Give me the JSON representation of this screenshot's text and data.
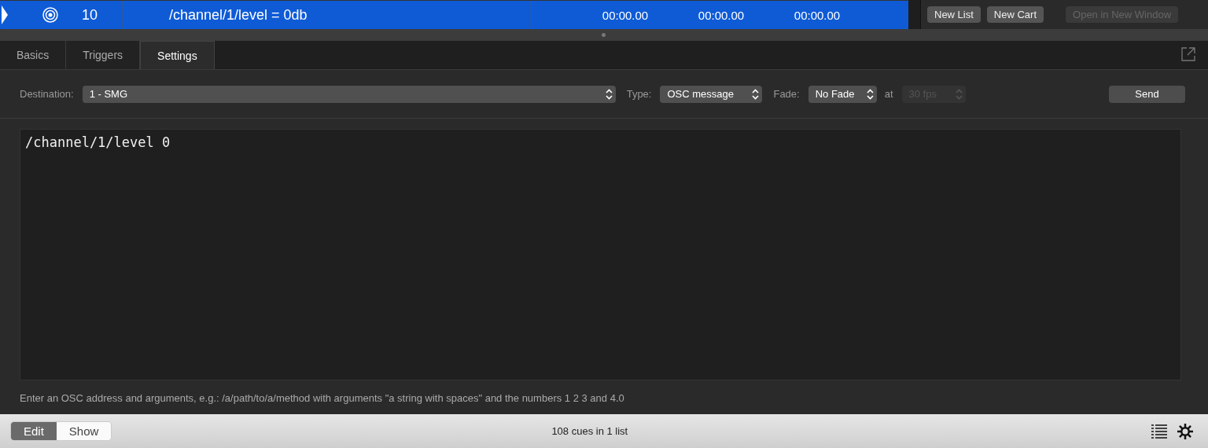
{
  "cue_row": {
    "selected": true,
    "number": "10",
    "name": "/channel/1/level = 0db",
    "times": [
      "00:00.00",
      "00:00.00",
      "00:00.00"
    ]
  },
  "list_buttons": [
    {
      "label": "New List",
      "disabled": false
    },
    {
      "label": "New Cart",
      "disabled": false
    },
    {
      "label": "Open in New Window",
      "disabled": true
    }
  ],
  "tabs": [
    {
      "label": "Basics",
      "selected": false
    },
    {
      "label": "Triggers",
      "selected": false
    },
    {
      "label": "Settings",
      "selected": true
    }
  ],
  "settings": {
    "destination_label": "Destination:",
    "destination": "1 - SMG",
    "type_label": "Type:",
    "type": "OSC message",
    "fade_label": "Fade:",
    "fade": "No Fade",
    "at_label": "at",
    "fps": "30 fps",
    "fps_disabled": true,
    "send": "Send"
  },
  "message": {
    "value": "/channel/1/level 0"
  },
  "hint": "Enter an OSC address and arguments, e.g.: /a/path/to/a/method with arguments \"a string with spaces\" and the numbers 1 2 3 and 4.0",
  "mode_switch": [
    {
      "label": "Edit",
      "selected": true
    },
    {
      "label": "Show",
      "selected": false
    }
  ],
  "status": "108 cues in 1 list"
}
